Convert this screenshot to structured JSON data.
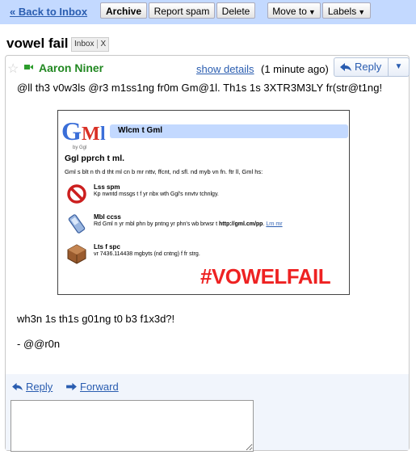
{
  "toolbar": {
    "back_label": "« Back to Inbox",
    "archive_label": "Archive",
    "report_spam_label": "Report spam",
    "delete_label": "Delete",
    "move_to_label": "Move to",
    "labels_label": "Labels",
    "bg_color": "#c3d9ff"
  },
  "thread": {
    "subject": "vowel fail",
    "label": "Inbox",
    "label_remove": "X"
  },
  "message": {
    "sender": "Aaron Niner",
    "show_details": "show details",
    "time": "(1 minute ago)",
    "reply_label": "Reply",
    "line1": "@ll th3 v0w3ls @r3 m1ss1ng fr0m Gm@1l. Th1s 1s 3XTR3M3LY fr(str@t1ng!",
    "line2": "wh3n 1s th1s g01ng t0 b3 f1x3d?!",
    "signature": "- @@r0n"
  },
  "embed": {
    "logo_text": "Gml",
    "logo_sub": "by Ggl",
    "welcome": "Wlcm t Gml",
    "approach_title": "Ggl pprch t ml.",
    "approach_sub": "Gml s blt n th d tht ml cn b mr nttv, ffcnt, nd sfl. nd myb vn fn. ftr ll, Gml hs:",
    "features": [
      {
        "icon": "no-sign-icon",
        "title": "Lss spm",
        "desc": "Kp nwntd mssgs t f yr nbx wth Ggl's nnvtv tchnlgy."
      },
      {
        "icon": "mobile-phone-icon",
        "title": "Mbl ccss",
        "desc_pre": "Rd Gml n yr mbl phn by pntng yr phn's wb brwsr t ",
        "desc_bold": "http://gml.cm/pp",
        "desc_mid": ". ",
        "desc_link": "Lrn mr"
      },
      {
        "icon": "storage-box-icon",
        "title": "Lts f spc",
        "desc": "vr 7436.114438 mgbyts (nd cntng) f fr strg."
      }
    ],
    "overlay_tag": "#VOWELFAIL",
    "overlay_color": "#ee2222"
  },
  "footer": {
    "reply_label": "Reply",
    "forward_label": "Forward",
    "reply_placeholder": ""
  }
}
